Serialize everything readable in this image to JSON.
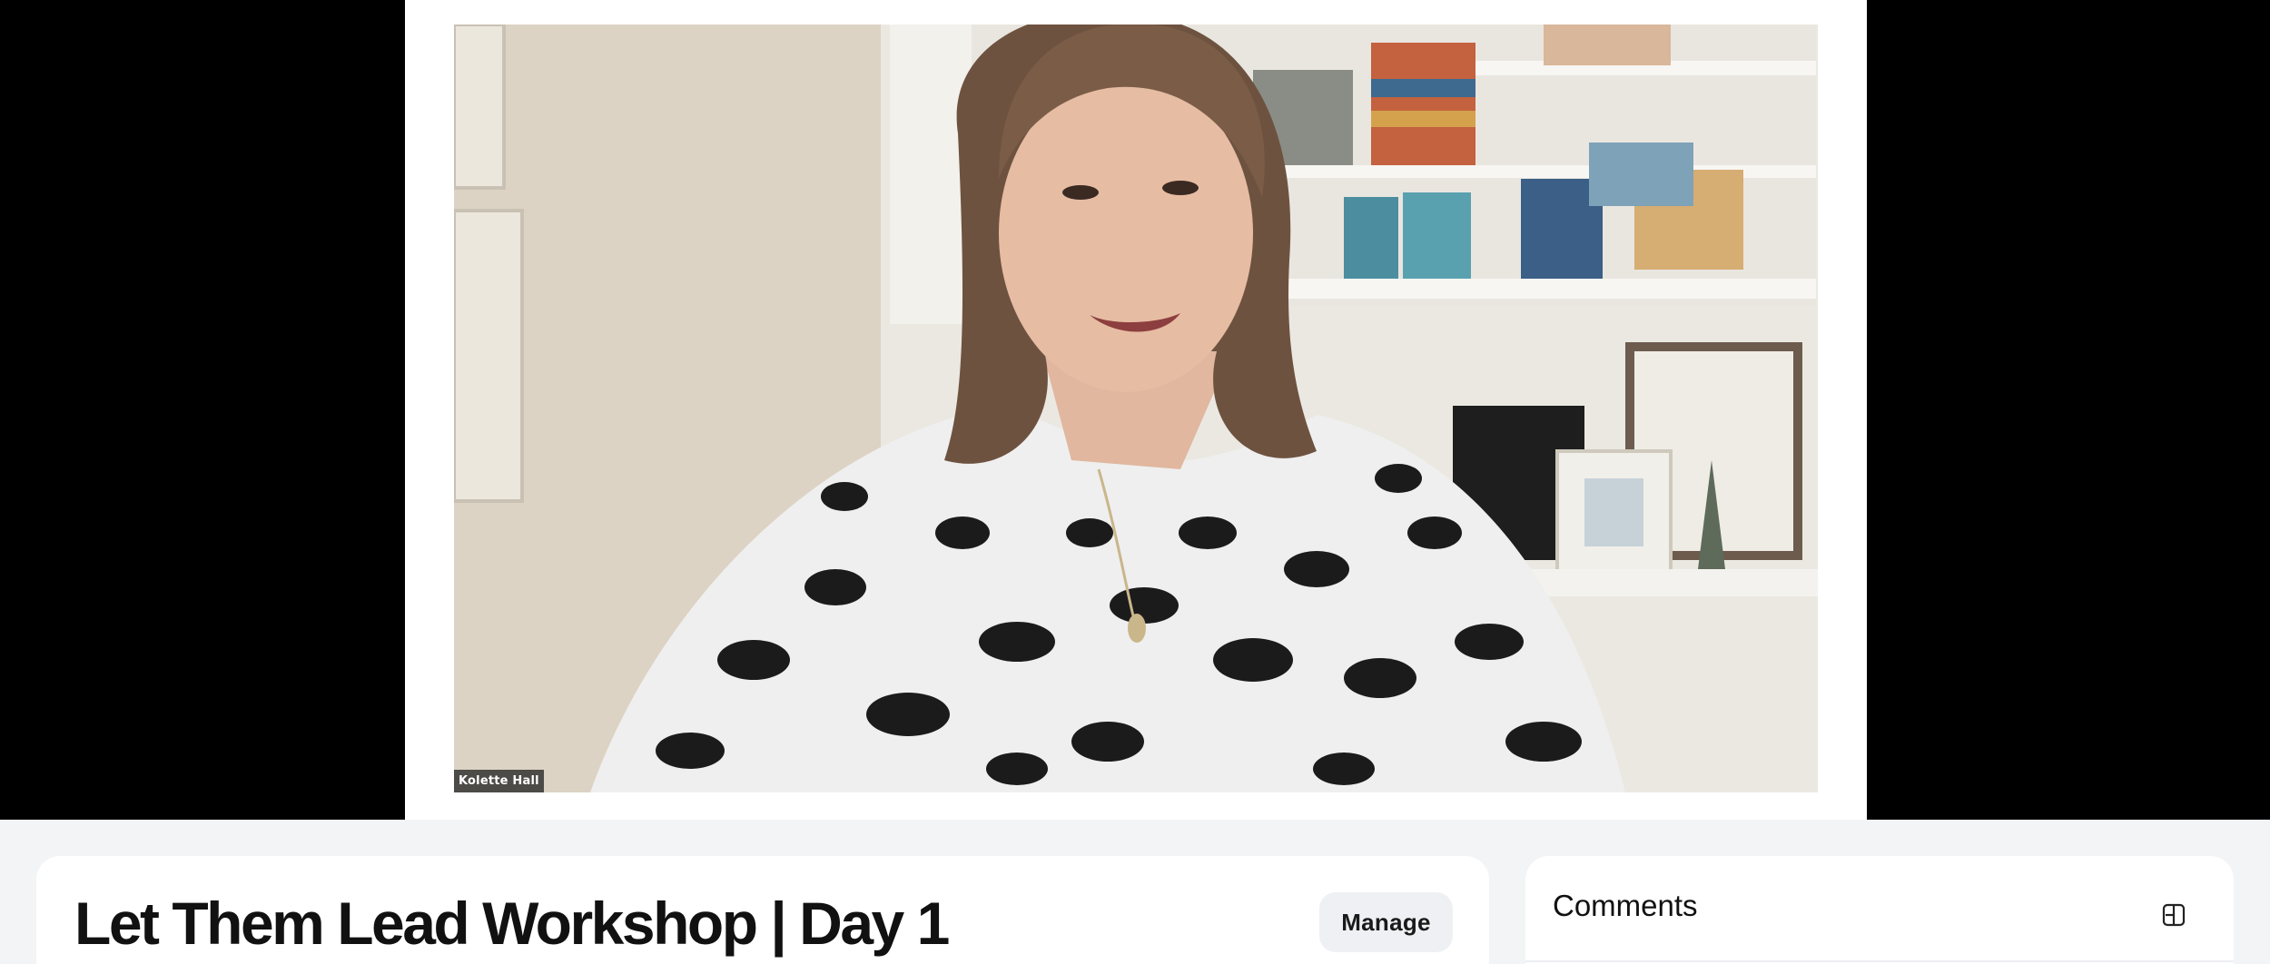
{
  "video": {
    "participant_name": "Kolette Hall",
    "background_color": "#000000",
    "frame_color": "#ffffff"
  },
  "event": {
    "title": "Let Them Lead Workshop | Day 1",
    "manage_label": "Manage"
  },
  "comments": {
    "title": "Comments",
    "toggle_icon": "panel-toggle-icon"
  }
}
